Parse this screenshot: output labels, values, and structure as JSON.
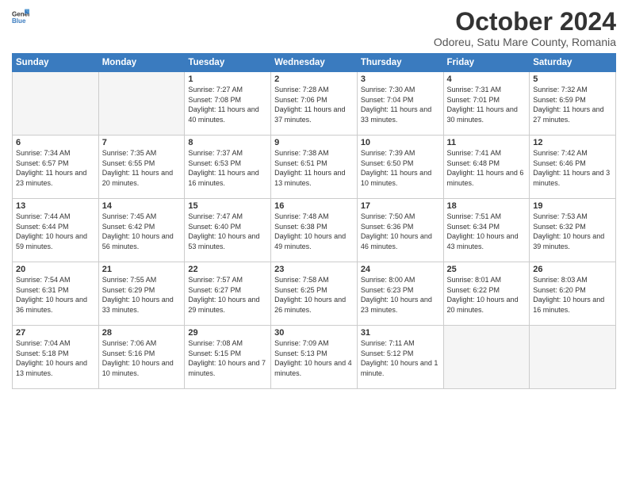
{
  "header": {
    "logo": {
      "general": "General",
      "blue": "Blue"
    },
    "title": "October 2024",
    "location": "Odoreu, Satu Mare County, Romania"
  },
  "weekdays": [
    "Sunday",
    "Monday",
    "Tuesday",
    "Wednesday",
    "Thursday",
    "Friday",
    "Saturday"
  ],
  "weeks": [
    [
      {
        "day": "",
        "empty": true
      },
      {
        "day": "",
        "empty": true
      },
      {
        "day": "1",
        "sunrise": "7:27 AM",
        "sunset": "7:08 PM",
        "daylight": "11 hours and 40 minutes."
      },
      {
        "day": "2",
        "sunrise": "7:28 AM",
        "sunset": "7:06 PM",
        "daylight": "11 hours and 37 minutes."
      },
      {
        "day": "3",
        "sunrise": "7:30 AM",
        "sunset": "7:04 PM",
        "daylight": "11 hours and 33 minutes."
      },
      {
        "day": "4",
        "sunrise": "7:31 AM",
        "sunset": "7:01 PM",
        "daylight": "11 hours and 30 minutes."
      },
      {
        "day": "5",
        "sunrise": "7:32 AM",
        "sunset": "6:59 PM",
        "daylight": "11 hours and 27 minutes."
      }
    ],
    [
      {
        "day": "6",
        "sunrise": "7:34 AM",
        "sunset": "6:57 PM",
        "daylight": "11 hours and 23 minutes."
      },
      {
        "day": "7",
        "sunrise": "7:35 AM",
        "sunset": "6:55 PM",
        "daylight": "11 hours and 20 minutes."
      },
      {
        "day": "8",
        "sunrise": "7:37 AM",
        "sunset": "6:53 PM",
        "daylight": "11 hours and 16 minutes."
      },
      {
        "day": "9",
        "sunrise": "7:38 AM",
        "sunset": "6:51 PM",
        "daylight": "11 hours and 13 minutes."
      },
      {
        "day": "10",
        "sunrise": "7:39 AM",
        "sunset": "6:50 PM",
        "daylight": "11 hours and 10 minutes."
      },
      {
        "day": "11",
        "sunrise": "7:41 AM",
        "sunset": "6:48 PM",
        "daylight": "11 hours and 6 minutes."
      },
      {
        "day": "12",
        "sunrise": "7:42 AM",
        "sunset": "6:46 PM",
        "daylight": "11 hours and 3 minutes."
      }
    ],
    [
      {
        "day": "13",
        "sunrise": "7:44 AM",
        "sunset": "6:44 PM",
        "daylight": "10 hours and 59 minutes."
      },
      {
        "day": "14",
        "sunrise": "7:45 AM",
        "sunset": "6:42 PM",
        "daylight": "10 hours and 56 minutes."
      },
      {
        "day": "15",
        "sunrise": "7:47 AM",
        "sunset": "6:40 PM",
        "daylight": "10 hours and 53 minutes."
      },
      {
        "day": "16",
        "sunrise": "7:48 AM",
        "sunset": "6:38 PM",
        "daylight": "10 hours and 49 minutes."
      },
      {
        "day": "17",
        "sunrise": "7:50 AM",
        "sunset": "6:36 PM",
        "daylight": "10 hours and 46 minutes."
      },
      {
        "day": "18",
        "sunrise": "7:51 AM",
        "sunset": "6:34 PM",
        "daylight": "10 hours and 43 minutes."
      },
      {
        "day": "19",
        "sunrise": "7:53 AM",
        "sunset": "6:32 PM",
        "daylight": "10 hours and 39 minutes."
      }
    ],
    [
      {
        "day": "20",
        "sunrise": "7:54 AM",
        "sunset": "6:31 PM",
        "daylight": "10 hours and 36 minutes."
      },
      {
        "day": "21",
        "sunrise": "7:55 AM",
        "sunset": "6:29 PM",
        "daylight": "10 hours and 33 minutes."
      },
      {
        "day": "22",
        "sunrise": "7:57 AM",
        "sunset": "6:27 PM",
        "daylight": "10 hours and 29 minutes."
      },
      {
        "day": "23",
        "sunrise": "7:58 AM",
        "sunset": "6:25 PM",
        "daylight": "10 hours and 26 minutes."
      },
      {
        "day": "24",
        "sunrise": "8:00 AM",
        "sunset": "6:23 PM",
        "daylight": "10 hours and 23 minutes."
      },
      {
        "day": "25",
        "sunrise": "8:01 AM",
        "sunset": "6:22 PM",
        "daylight": "10 hours and 20 minutes."
      },
      {
        "day": "26",
        "sunrise": "8:03 AM",
        "sunset": "6:20 PM",
        "daylight": "10 hours and 16 minutes."
      }
    ],
    [
      {
        "day": "27",
        "sunrise": "7:04 AM",
        "sunset": "5:18 PM",
        "daylight": "10 hours and 13 minutes."
      },
      {
        "day": "28",
        "sunrise": "7:06 AM",
        "sunset": "5:16 PM",
        "daylight": "10 hours and 10 minutes."
      },
      {
        "day": "29",
        "sunrise": "7:08 AM",
        "sunset": "5:15 PM",
        "daylight": "10 hours and 7 minutes."
      },
      {
        "day": "30",
        "sunrise": "7:09 AM",
        "sunset": "5:13 PM",
        "daylight": "10 hours and 4 minutes."
      },
      {
        "day": "31",
        "sunrise": "7:11 AM",
        "sunset": "5:12 PM",
        "daylight": "10 hours and 1 minute."
      },
      {
        "day": "",
        "empty": true
      },
      {
        "day": "",
        "empty": true
      }
    ]
  ]
}
